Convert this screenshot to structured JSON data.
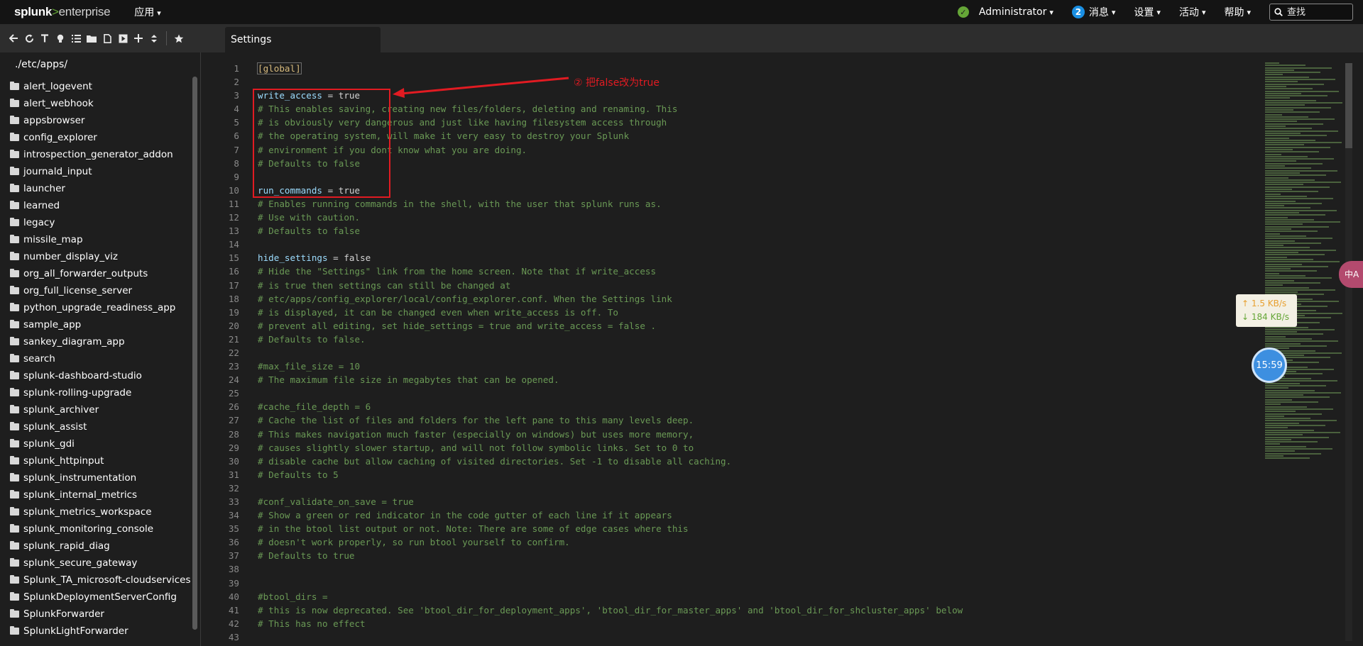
{
  "topbar": {
    "logo_main": "splunk",
    "logo_gt": ">",
    "logo_enterprise": "enterprise",
    "app_menu": "应用",
    "user": "Administrator",
    "messages_count": "2",
    "messages": "消息",
    "settings": "设置",
    "activity": "活动",
    "help": "帮助",
    "search_placeholder": "查找"
  },
  "toolbar": {
    "tab_label": "Settings",
    "icons": [
      "back-arrow-icon",
      "refresh-icon",
      "text-icon",
      "lightbulb-icon",
      "list-icon",
      "folder-icon",
      "file-icon",
      "run-icon",
      "plus-icon",
      "sort-icon",
      "star-icon"
    ]
  },
  "sidebar": {
    "path": "./etc/apps/",
    "items": [
      "alert_logevent",
      "alert_webhook",
      "appsbrowser",
      "config_explorer",
      "introspection_generator_addon",
      "journald_input",
      "launcher",
      "learned",
      "legacy",
      "missile_map",
      "number_display_viz",
      "org_all_forwarder_outputs",
      "org_full_license_server",
      "python_upgrade_readiness_app",
      "sample_app",
      "sankey_diagram_app",
      "search",
      "splunk-dashboard-studio",
      "splunk-rolling-upgrade",
      "splunk_archiver",
      "splunk_assist",
      "splunk_gdi",
      "splunk_httpinput",
      "splunk_instrumentation",
      "splunk_internal_metrics",
      "splunk_metrics_workspace",
      "splunk_monitoring_console",
      "splunk_rapid_diag",
      "splunk_secure_gateway",
      "Splunk_TA_microsoft-cloudservices",
      "SplunkDeploymentServerConfig",
      "SplunkForwarder",
      "SplunkLightForwarder"
    ]
  },
  "editor": {
    "line_numbers": [
      "1",
      "2",
      "3",
      "4",
      "5",
      "6",
      "7",
      "8",
      "9",
      "10",
      "11",
      "12",
      "13",
      "14",
      "15",
      "16",
      "17",
      "18",
      "19",
      "20",
      "21",
      "22",
      "23",
      "24",
      "25",
      "26",
      "27",
      "28",
      "29",
      "30",
      "31",
      "32",
      "33",
      "34",
      "35",
      "36",
      "37",
      "38",
      "39",
      "40",
      "41",
      "42",
      "43"
    ],
    "lines": [
      {
        "t": "sec",
        "text": "[global]"
      },
      {
        "t": "blank",
        "text": ""
      },
      {
        "t": "kv",
        "key": "write_access",
        "val": "true"
      },
      {
        "t": "c",
        "text": "# This enables saving, creating new files/folders, deleting and renaming. This"
      },
      {
        "t": "c",
        "text": "# is obviously very dangerous and just like having filesystem access through"
      },
      {
        "t": "c",
        "text": "# the operating system, will make it very easy to destroy your Splunk"
      },
      {
        "t": "c",
        "text": "# environment if you dont know what you are doing."
      },
      {
        "t": "c",
        "text": "# Defaults to false"
      },
      {
        "t": "blank",
        "text": ""
      },
      {
        "t": "kv",
        "key": "run_commands",
        "val": "true"
      },
      {
        "t": "c",
        "text": "# Enables running commands in the shell, with the user that splunk runs as."
      },
      {
        "t": "c",
        "text": "# Use with caution."
      },
      {
        "t": "c",
        "text": "# Defaults to false"
      },
      {
        "t": "blank",
        "text": ""
      },
      {
        "t": "kv",
        "key": "hide_settings",
        "val": "false"
      },
      {
        "t": "c",
        "text": "# Hide the \"Settings\" link from the home screen. Note that if write_access"
      },
      {
        "t": "c",
        "text": "# is true then settings can still be changed at"
      },
      {
        "t": "c",
        "text": "# etc/apps/config_explorer/local/config_explorer.conf. When the Settings link"
      },
      {
        "t": "c",
        "text": "# is displayed, it can be changed even when write_access is off. To"
      },
      {
        "t": "c",
        "text": "# prevent all editing, set hide_settings = true and write_access = false ."
      },
      {
        "t": "c",
        "text": "# Defaults to false."
      },
      {
        "t": "blank",
        "text": ""
      },
      {
        "t": "c",
        "text": "#max_file_size = 10"
      },
      {
        "t": "c",
        "text": "# The maximum file size in megabytes that can be opened."
      },
      {
        "t": "blank",
        "text": ""
      },
      {
        "t": "c",
        "text": "#cache_file_depth = 6"
      },
      {
        "t": "c",
        "text": "# Cache the list of files and folders for the left pane to this many levels deep."
      },
      {
        "t": "c",
        "text": "# This makes navigation much faster (especially on windows) but uses more memory,"
      },
      {
        "t": "c",
        "text": "# causes slightly slower startup, and will not follow symbolic links. Set to 0 to"
      },
      {
        "t": "c",
        "text": "# disable cache but allow caching of visited directories. Set -1 to disable all caching."
      },
      {
        "t": "c",
        "text": "# Defaults to 5"
      },
      {
        "t": "blank",
        "text": ""
      },
      {
        "t": "c",
        "text": "#conf_validate_on_save = true"
      },
      {
        "t": "c",
        "text": "# Show a green or red indicator in the code gutter of each line if it appears"
      },
      {
        "t": "c",
        "text": "# in the btool list output or not. Note: There are some of edge cases where this"
      },
      {
        "t": "c",
        "text": "# doesn't work properly, so run btool yourself to confirm."
      },
      {
        "t": "c",
        "text": "# Defaults to true"
      },
      {
        "t": "blank",
        "text": ""
      },
      {
        "t": "blank",
        "text": ""
      },
      {
        "t": "c",
        "text": "#btool_dirs ="
      },
      {
        "t": "c",
        "text": "# this is now deprecated. See 'btool_dir_for_deployment_apps', 'btool_dir_for_master_apps' and 'btool_dir_for_shcluster_apps' below"
      },
      {
        "t": "c",
        "text": "# This has no effect"
      },
      {
        "t": "blank",
        "text": ""
      }
    ],
    "annotation": "② 把false改为true"
  },
  "overlays": {
    "upload_speed": "↑ 1.5 KB/s",
    "download_speed": "↓ 184 KB/s",
    "clock": "15:59",
    "translate_label": "中A"
  },
  "colors": {
    "accent_green": "#65a637",
    "annotation_red": "#e11b22",
    "comment": "#6a9955",
    "key": "#9cdcfe"
  }
}
